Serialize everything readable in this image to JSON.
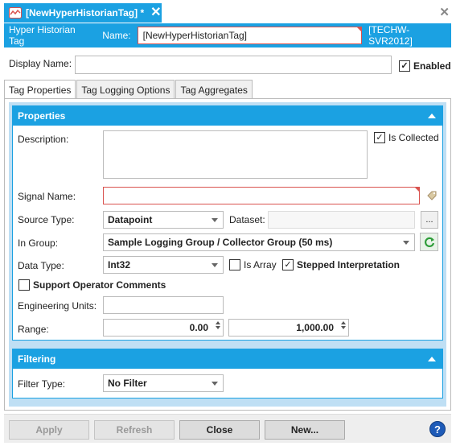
{
  "document_tab": {
    "title": "[NewHyperHistorianTag] *",
    "close": "✕"
  },
  "window_close": "✕",
  "header": {
    "type_label": "Hyper Historian Tag",
    "name_label": "Name:",
    "name_value": "[NewHyperHistorianTag]",
    "server": "[TECHW-SVR2012]"
  },
  "display_name": {
    "label": "Display Name:",
    "value": ""
  },
  "enabled": {
    "label": "Enabled",
    "checked": true
  },
  "tabs": [
    {
      "label": "Tag Properties",
      "active": true
    },
    {
      "label": "Tag Logging Options",
      "active": false
    },
    {
      "label": "Tag Aggregates",
      "active": false
    }
  ],
  "properties": {
    "title": "Properties",
    "description_label": "Description:",
    "description_value": "",
    "is_collected_label": "Is Collected",
    "is_collected_checked": true,
    "signal_name_label": "Signal Name:",
    "signal_name_value": "",
    "source_type_label": "Source Type:",
    "source_type_value": "Datapoint",
    "dataset_label": "Dataset:",
    "dataset_value": "",
    "browse_label": "...",
    "in_group_label": "In Group:",
    "in_group_value": "Sample Logging Group / Collector Group (50 ms)",
    "data_type_label": "Data Type:",
    "data_type_value": "Int32",
    "is_array_label": "Is Array",
    "is_array_checked": false,
    "stepped_label": "Stepped Interpretation",
    "stepped_checked": true,
    "support_comments_label": "Support Operator Comments",
    "support_comments_checked": false,
    "eng_units_label": "Engineering Units:",
    "eng_units_value": "",
    "range_label": "Range:",
    "range_low": "0.00",
    "range_high": "1,000.00"
  },
  "filtering": {
    "title": "Filtering",
    "filter_type_label": "Filter Type:",
    "filter_type_value": "No Filter"
  },
  "buttons": {
    "apply": "Apply",
    "refresh": "Refresh",
    "close": "Close",
    "new": "New...",
    "help": "?"
  },
  "colors": {
    "accent": "#1ba1e2",
    "error_border": "#d9534f",
    "panel_bg": "#bfdff4"
  },
  "icons": [
    "tag-icon",
    "close-icon",
    "tag-browse-icon",
    "refresh-icon",
    "help-icon",
    "collapse-icon"
  ]
}
